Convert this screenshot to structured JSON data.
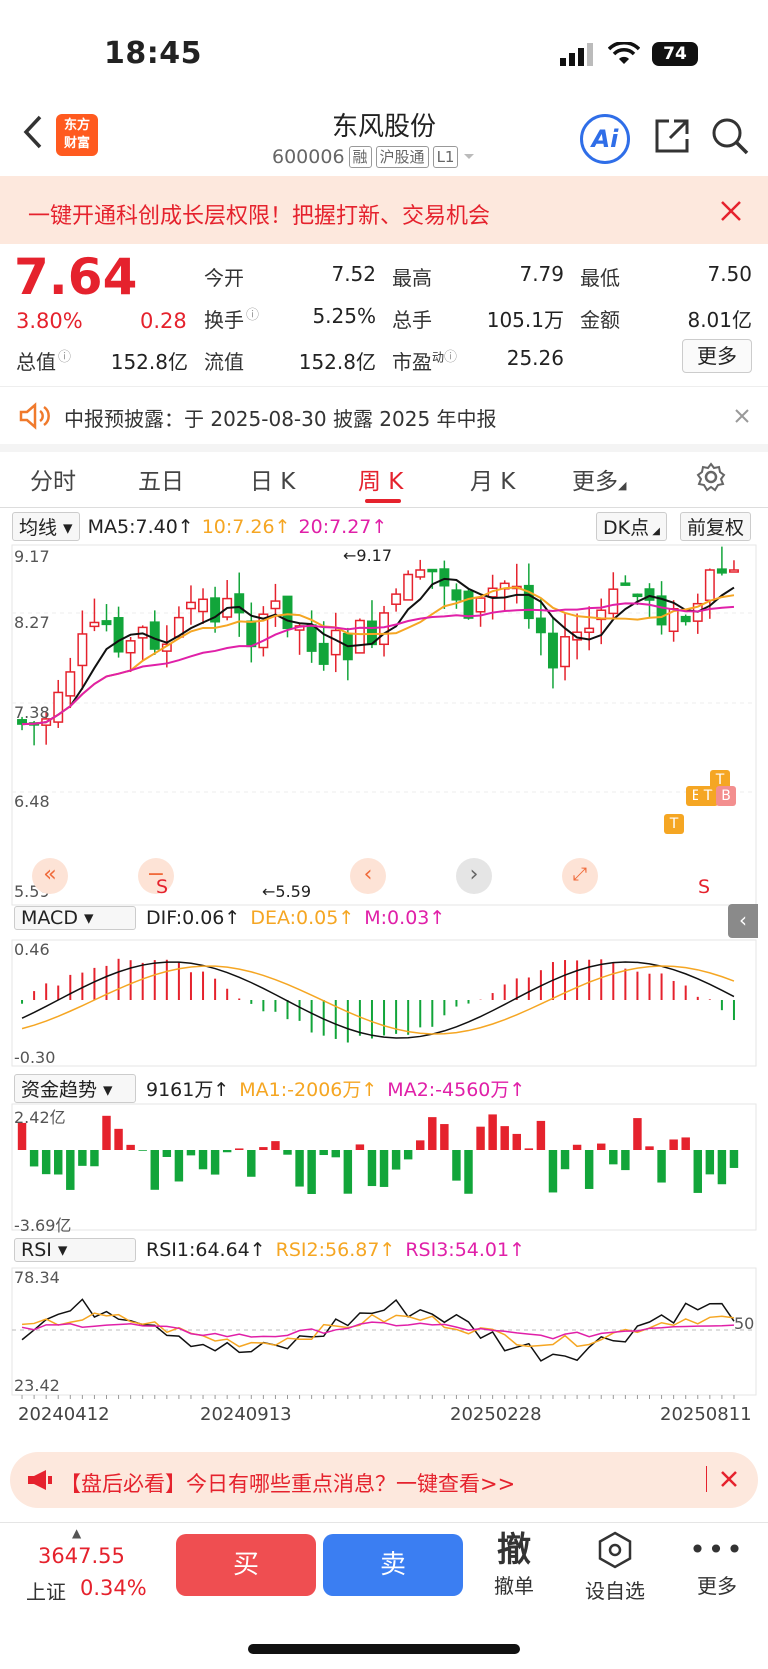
{
  "status": {
    "time": "18:45",
    "battery": "74"
  },
  "header": {
    "name": "东风股份",
    "code": "600006",
    "tags": [
      "融",
      "沪股通",
      "L1"
    ],
    "logo_line1": "东方",
    "logo_line2": "财富",
    "ai": "Ai"
  },
  "banner": {
    "text": "一键开通科创成长层权限！把握打新、交易机会"
  },
  "quote": {
    "price": "7.64",
    "pct": "3.80%",
    "change": "0.28",
    "open_lbl": "今开",
    "open": "7.52",
    "high_lbl": "最高",
    "high": "7.79",
    "low_lbl": "最低",
    "low": "7.50",
    "turnover_lbl": "换手",
    "turnover": "5.25%",
    "volume_lbl": "总手",
    "volume": "105.1万",
    "amount_lbl": "金额",
    "amount": "8.01亿",
    "mktcap_lbl": "总值",
    "mktcap": "152.8亿",
    "float_lbl": "流值",
    "float": "152.8亿",
    "pe_lbl": "市盈",
    "pe_sup": "动",
    "pe": "25.26",
    "more": "更多"
  },
  "notice": {
    "text": "中报预披露：于 2025-08-30 披露 2025 年中报"
  },
  "tabs": [
    "分时",
    "五日",
    "日 K",
    "周 K",
    "月 K",
    "更多"
  ],
  "kline": {
    "selector": "均线",
    "ma5": "MA5:7.40",
    "ma10": "10:7.26",
    "ma20": "20:7.27",
    "dk": "DK点",
    "adj": "前复权",
    "y_labels": [
      "9.17",
      "8.27",
      "7.38",
      "6.48",
      "5.59"
    ],
    "max_label": "9.17",
    "min_label": "5.59",
    "markers": [
      "T",
      "E",
      "T",
      "T",
      "B"
    ],
    "s_markers": [
      "S",
      "S"
    ]
  },
  "macd": {
    "selector": "MACD",
    "dif": "DIF:0.06",
    "dea": "DEA:0.05",
    "m": "M:0.03",
    "y_top": "0.46",
    "y_bottom": "-0.30"
  },
  "fund": {
    "selector": "资金趋势",
    "value": "9161万",
    "ma1": "MA1:-2006万",
    "ma2": "MA2:-4560万",
    "y_top": "2.42亿",
    "y_bottom": "-3.69亿"
  },
  "rsi": {
    "selector": "RSI",
    "rsi1": "RSI1:64.64",
    "rsi2": "RSI2:56.87",
    "rsi3": "RSI3:54.01",
    "y_top": "78.34",
    "y_bottom": "23.42",
    "mid": "50"
  },
  "dates": [
    "20240412",
    "20240913",
    "20250228",
    "20250811"
  ],
  "bottom_banner": {
    "text": "【盘后必看】今日有哪些重点消息？一键查看>>"
  },
  "bottom": {
    "index_value": "3647.55",
    "index_name": "上证",
    "index_pct": "0.34%",
    "buy": "买",
    "sell": "卖",
    "cancel_big": "撤",
    "cancel": "撤单",
    "watch": "设自选",
    "more": "更多"
  },
  "colors": {
    "up": "#e5222d",
    "down": "#12a53a",
    "ma5": "#111111",
    "ma10": "#f5a623",
    "ma20": "#e020a8"
  }
}
